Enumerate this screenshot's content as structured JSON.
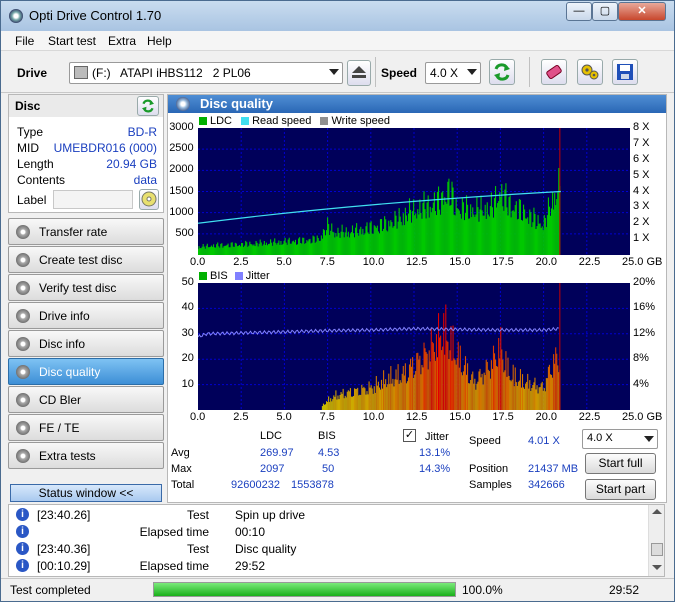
{
  "window": {
    "title": "Opti Drive Control 1.70",
    "minimize": "—",
    "maximize": "▢",
    "close": "✕"
  },
  "menu": [
    "File",
    "Start test",
    "Extra",
    "Help"
  ],
  "toolbar": {
    "drive_label": "Drive",
    "drive_value": "(F:)   ATAPI iHBS112   2 PL06",
    "speed_label": "Speed",
    "speed_value": "4.0 X"
  },
  "disc": {
    "header": "Disc",
    "rows": [
      {
        "k": "Type",
        "v": "BD-R"
      },
      {
        "k": "MID",
        "v": "UMEBDR016 (000)"
      },
      {
        "k": "Length",
        "v": "20.94 GB"
      },
      {
        "k": "Contents",
        "v": "data"
      }
    ],
    "label_key": "Label",
    "label_value": ""
  },
  "nav": [
    "Transfer rate",
    "Create test disc",
    "Verify test disc",
    "Drive info",
    "Disc info",
    "Disc quality",
    "CD Bler",
    "FE / TE",
    "Extra tests"
  ],
  "nav_active": "Disc quality",
  "status_window_button": "Status window <<",
  "panel": {
    "title": "Disc quality"
  },
  "chart_data": [
    {
      "type": "area",
      "legend": [
        "LDC",
        "Read speed",
        "Write speed"
      ],
      "colors": {
        "ldc": "#00c800",
        "read": "#40e0f0",
        "write": "#a0a0a0",
        "spike": "#c80000"
      },
      "x_ticks": [
        "0.0",
        "2.5",
        "5.0",
        "7.5",
        "10.0",
        "12.5",
        "15.0",
        "17.5",
        "20.0",
        "22.5",
        "25.0 GB"
      ],
      "y_left_ticks": [
        "3000",
        "2500",
        "2000",
        "1500",
        "1000",
        "500"
      ],
      "y_right_ticks": [
        "8 X",
        "7 X",
        "6 X",
        "5 X",
        "4 X",
        "3 X",
        "2 X",
        "1 X"
      ],
      "xlim": [
        0,
        25
      ],
      "ylim": [
        0,
        3000
      ],
      "ldc_x": [
        0,
        1,
        2,
        3,
        4,
        5,
        6,
        7,
        7.5,
        8,
        9,
        10,
        11,
        11.5,
        12,
        12.5,
        13,
        14,
        14.5,
        15,
        16,
        17,
        17.5,
        18,
        19,
        20,
        20.5,
        20.94
      ],
      "ldc_y": [
        250,
        300,
        320,
        350,
        380,
        420,
        450,
        500,
        900,
        700,
        750,
        850,
        1000,
        1100,
        1300,
        1400,
        1500,
        1700,
        2050,
        1500,
        1400,
        1500,
        2000,
        1600,
        1300,
        950,
        1700,
        2200
      ],
      "read_speed_x": [
        0,
        21
      ],
      "read_speed_y": [
        2.0,
        4.0
      ]
    },
    {
      "type": "area",
      "legend": [
        "BIS",
        "Jitter"
      ],
      "colors": {
        "bis_low": "#c8c800",
        "bis_high": "#e02000",
        "jitter": "#8080ff"
      },
      "x_ticks": [
        "0.0",
        "2.5",
        "5.0",
        "7.5",
        "10.0",
        "12.5",
        "15.0",
        "17.5",
        "20.0",
        "22.5",
        "25.0 GB"
      ],
      "y_left_ticks": [
        "50",
        "40",
        "30",
        "20",
        "10"
      ],
      "y_right_ticks": [
        "20%",
        "16%",
        "12%",
        "8%",
        "4%"
      ],
      "xlim": [
        0,
        25
      ],
      "ylim": [
        0,
        50
      ],
      "bis_x": [
        0,
        2,
        4,
        6,
        7,
        7.5,
        8,
        9,
        10,
        11,
        12,
        12.5,
        13,
        14,
        14.2,
        15,
        16,
        17,
        17.5,
        18,
        19,
        20,
        20.5,
        20.94
      ],
      "bis_y": [
        0,
        0,
        0,
        0,
        1,
        5,
        8,
        10,
        12,
        17,
        20,
        25,
        28,
        40,
        45,
        30,
        15,
        25,
        35,
        20,
        15,
        12,
        25,
        30
      ],
      "jitter_x": [
        0,
        0.5,
        2,
        5,
        7.5,
        10,
        12.5,
        15,
        17.5,
        20,
        20.94
      ],
      "jitter_y": [
        11.5,
        12.0,
        12.1,
        12.3,
        12.5,
        12.6,
        12.8,
        12.7,
        12.6,
        12.6,
        12.8
      ]
    }
  ],
  "stats": {
    "col_ldc": "LDC",
    "col_bis": "BIS",
    "jitter_check": "✓",
    "col_jitter": "Jitter",
    "avg_label": "Avg",
    "max_label": "Max",
    "total_label": "Total",
    "avg_ldc": "269.97",
    "avg_bis": "4.53",
    "avg_jitter": "13.1%",
    "max_ldc": "2097",
    "max_bis": "50",
    "max_jitter": "14.3%",
    "total_ldc": "92600232",
    "total_bis": "1553878",
    "speed_label": "Speed",
    "speed_value": "4.01 X",
    "speed_combo": "4.0 X",
    "position_label": "Position",
    "position_value": "21437 MB",
    "samples_label": "Samples",
    "samples_value": "342666",
    "start_full": "Start full",
    "start_part": "Start part"
  },
  "log": [
    {
      "a": "[23:40.26]",
      "b": "Test",
      "c": "Spin up drive"
    },
    {
      "a": "Elapsed time",
      "b": "",
      "c": "00:10",
      "split": true
    },
    {
      "a": "[23:40.36]",
      "b": "Test",
      "c": "Disc quality"
    },
    {
      "a": "[00:10.29]",
      "b": "Elapsed time",
      "c": "29:52"
    }
  ],
  "statusbar": {
    "text": "Test completed",
    "progress_percent": 100,
    "progress_text": "100.0%",
    "time": "29:52"
  }
}
